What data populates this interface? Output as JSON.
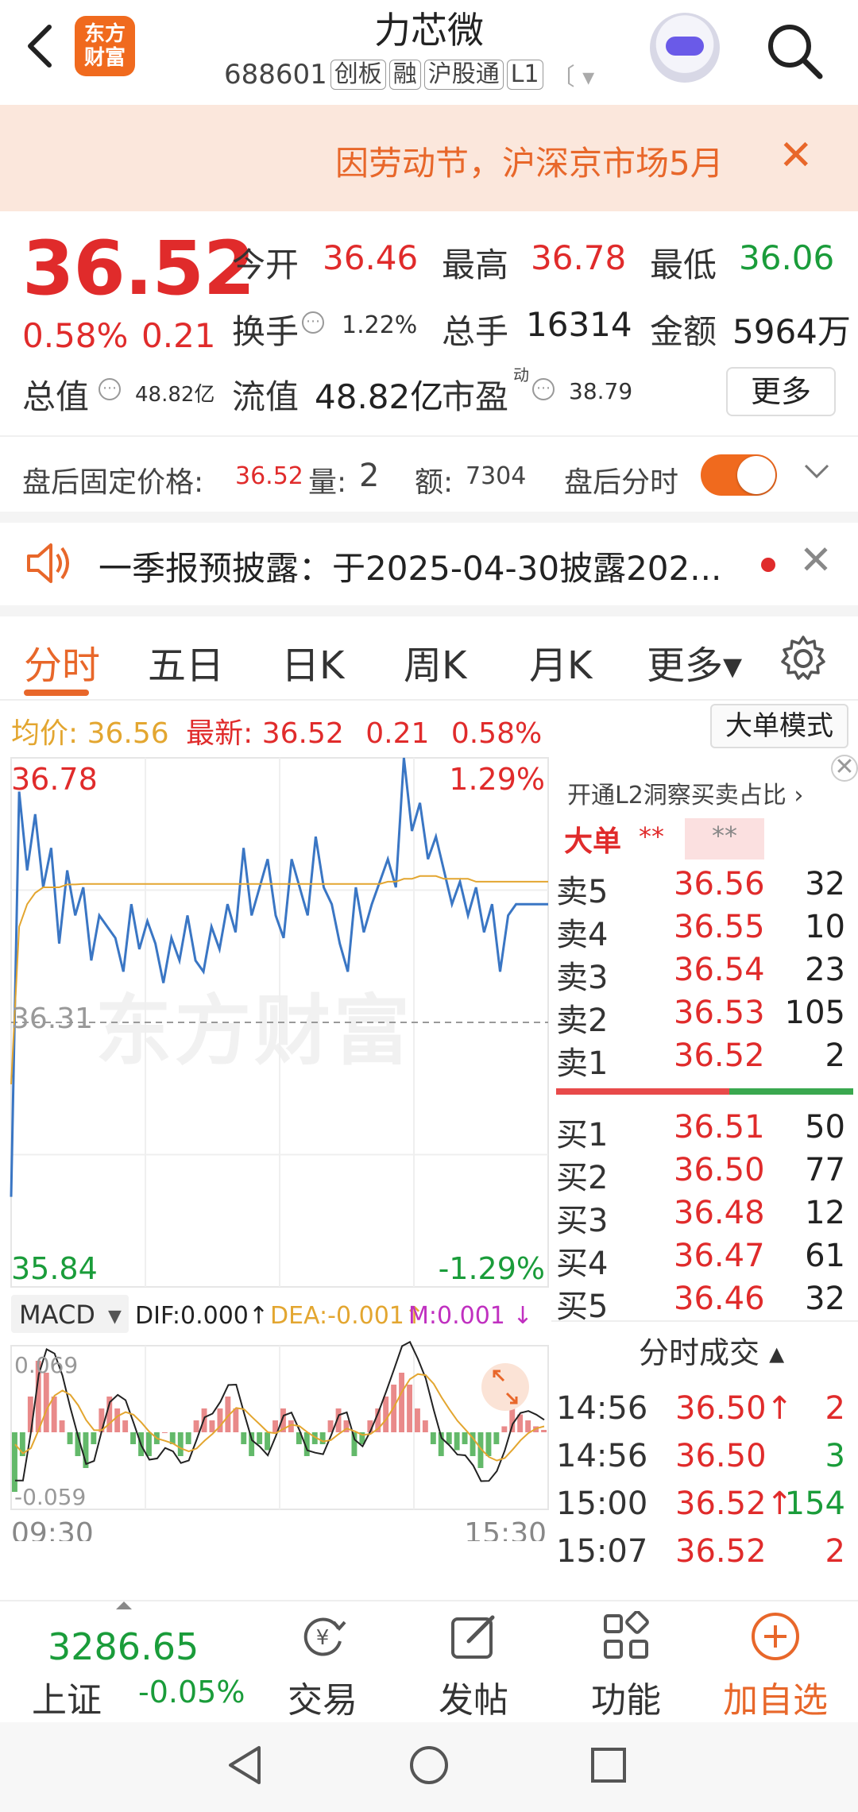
{
  "header": {
    "stock_name": "力芯微",
    "stock_code": "688601",
    "tags": [
      "创板",
      "融",
      "沪股通",
      "L1"
    ],
    "tag_more": "〔",
    "logo_text_1": "东方",
    "logo_text_2": "财富"
  },
  "notice": {
    "text": "因劳动节，沪深京市场5月"
  },
  "quote": {
    "price": "36.52",
    "change_pct": "0.58%",
    "change": "0.21",
    "open_label": "今开",
    "open": "36.46",
    "high_label": "最高",
    "high": "36.78",
    "low_label": "最低",
    "low": "36.06",
    "turnover_label": "换手",
    "turnover": "1.22%",
    "volume_label": "总手",
    "volume": "16314",
    "amount_label": "金额",
    "amount": "5964万",
    "mktcap_label": "总值",
    "mktcap": "48.82亿",
    "float_label": "流值",
    "float": "48.82亿",
    "pe_label": "市盈",
    "pe_sup": "动",
    "pe": "38.79",
    "more_label": "更多"
  },
  "after_hours": {
    "label": "盘后固定价格:",
    "price": "36.52",
    "vol_label": "量:",
    "vol": "2",
    "amt_label": "额:",
    "amt": "7304",
    "toggle_label": "盘后分时",
    "toggle_on": true
  },
  "announcement": {
    "text": "一季报预披露：于2025-04-30披露202..."
  },
  "tabs": [
    "分时",
    "五日",
    "日K",
    "周K",
    "月K",
    "更多▾"
  ],
  "avg_bar": {
    "avg_label": "均价:",
    "avg": "36.56",
    "last_label": "最新:",
    "last": "36.52",
    "chg": "0.21",
    "pct": "0.58%",
    "big_order_mode": "大单模式"
  },
  "chart_data": {
    "type": "line",
    "title": "",
    "ylim": [
      35.84,
      36.78
    ],
    "pct_range": [
      "1.29%",
      "-1.29%"
    ],
    "ref_price": "36.31",
    "y_top_label": "36.78",
    "y_bottom_label": "35.84",
    "pct_top_label": "1.29%",
    "pct_bottom_label": "-1.29%",
    "x_labels": [
      "09:30",
      "15:30"
    ],
    "series": [
      {
        "values": [
          36.0,
          36.72,
          36.58,
          36.68,
          36.55,
          36.62,
          36.45,
          36.58,
          36.5,
          36.55,
          36.42,
          36.5,
          36.48,
          36.46,
          36.4,
          36.52,
          36.44,
          36.49,
          36.45,
          36.38,
          36.46,
          36.42,
          36.5,
          36.42,
          36.4,
          36.48,
          36.44,
          36.52,
          36.47,
          36.62,
          36.5,
          36.55,
          36.6,
          36.5,
          36.46,
          36.6,
          36.55,
          36.5,
          36.64,
          36.55,
          36.52,
          36.45,
          36.4,
          36.55,
          36.47,
          36.52,
          36.56,
          36.6,
          36.55,
          36.78,
          36.65,
          36.7,
          36.6,
          36.64,
          36.58,
          36.52,
          36.56,
          36.5,
          36.55,
          36.47,
          36.52,
          36.4,
          36.5,
          36.52,
          36.52,
          36.52,
          36.52,
          36.52
        ]
      },
      {
        "values": [
          36.2,
          36.48,
          36.52,
          36.54,
          36.55,
          36.55,
          36.55,
          36.555,
          36.555,
          36.556,
          36.556,
          36.556,
          36.556,
          36.556,
          36.556,
          36.556,
          36.556,
          36.556,
          36.556,
          36.556,
          36.556,
          36.556,
          36.556,
          36.556,
          36.556,
          36.556,
          36.556,
          36.556,
          36.556,
          36.556,
          36.556,
          36.556,
          36.556,
          36.556,
          36.556,
          36.556,
          36.556,
          36.556,
          36.556,
          36.556,
          36.556,
          36.556,
          36.556,
          36.556,
          36.556,
          36.556,
          36.556,
          36.56,
          36.56,
          36.565,
          36.565,
          36.57,
          36.57,
          36.57,
          36.565,
          36.565,
          36.565,
          36.565,
          36.56,
          36.56,
          36.56,
          36.56,
          36.56,
          36.56,
          36.56,
          36.56,
          36.56,
          36.56
        ]
      }
    ],
    "macd": {
      "label": "MACD",
      "dif_label": "DIF:0.000↑",
      "dea_label": "DEA:-0.001↑",
      "m_label": "M:0.001 ↓",
      "top_label": "0.069",
      "bottom_label": "-0.059",
      "bars": [
        -0.05,
        -0.02,
        0.03,
        0.06,
        0.05,
        0.03,
        0.01,
        -0.01,
        -0.02,
        -0.03,
        -0.01,
        0.02,
        0.03,
        0.02,
        0.01,
        -0.01,
        -0.02,
        -0.02,
        -0.01,
        0,
        -0.01,
        -0.02,
        -0.01,
        0.01,
        0.02,
        0.01,
        0.02,
        0.03,
        0.02,
        -0.01,
        -0.02,
        -0.01,
        -0.015,
        0.01,
        0.02,
        0.01,
        -0.01,
        -0.02,
        -0.01,
        -0.01,
        0.01,
        0.02,
        0.01,
        -0.02,
        -0.01,
        0.01,
        0.02,
        0.03,
        0.04,
        0.05,
        0.04,
        0.02,
        0.01,
        -0.01,
        -0.02,
        -0.01,
        -0.015,
        -0.01,
        -0.02,
        -0.03,
        -0.02,
        -0.01,
        0.005,
        0.02,
        0.015,
        0.01,
        0.005,
        0.002
      ]
    }
  },
  "order_book": {
    "l2_text": "开通L2洞察买卖占比 ›",
    "big_label": "大单",
    "big_v1": "**",
    "big_v2": "**",
    "asks": [
      {
        "label": "卖5",
        "price": "36.56",
        "vol": "32"
      },
      {
        "label": "卖4",
        "price": "36.55",
        "vol": "10"
      },
      {
        "label": "卖3",
        "price": "36.54",
        "vol": "23"
      },
      {
        "label": "卖2",
        "price": "36.53",
        "vol": "105"
      },
      {
        "label": "卖1",
        "price": "36.52",
        "vol": "2"
      }
    ],
    "bids": [
      {
        "label": "买1",
        "price": "36.51",
        "vol": "50"
      },
      {
        "label": "买2",
        "price": "36.50",
        "vol": "77"
      },
      {
        "label": "买3",
        "price": "36.48",
        "vol": "12"
      },
      {
        "label": "买4",
        "price": "36.47",
        "vol": "61"
      },
      {
        "label": "买5",
        "price": "36.46",
        "vol": "32"
      }
    ],
    "trades_title": "分时成交 ▴",
    "trades": [
      {
        "time": "14:56",
        "price": "36.50↑",
        "vol": "2"
      },
      {
        "time": "14:56",
        "price": "36.50",
        "vol": "3"
      },
      {
        "time": "15:00",
        "price": "36.52↑",
        "vol": "154"
      },
      {
        "time": "15:07",
        "price": "36.52",
        "vol": "2"
      }
    ]
  },
  "bottom_nav": {
    "index_value": "3286.65",
    "index_name": "上证",
    "index_change": "-0.05%",
    "items": [
      {
        "label": "交易",
        "icon": "yen-cycle-icon"
      },
      {
        "label": "发帖",
        "icon": "edit-icon"
      },
      {
        "label": "功能",
        "icon": "grid-icon"
      },
      {
        "label": "加自选",
        "icon": "add-circle-icon"
      }
    ]
  },
  "colors": {
    "accent": "#e8672a",
    "up": "#e02b2b",
    "down": "#1a9c3a",
    "price_line": "#3a76c4",
    "avg_line": "#e3a630"
  }
}
